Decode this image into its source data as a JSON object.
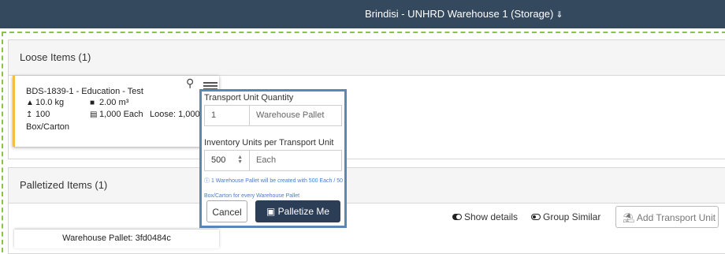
{
  "header": {
    "location": "Brindisi - UNHRD Warehouse 1 (Storage)",
    "chevron_icon": "double-chevron-down"
  },
  "loose": {
    "title": "Loose Items (1)",
    "card": {
      "title": "BDS-1839-1 - Education - Test",
      "weight": "10.0 kg",
      "volume": "2.00 m³",
      "units": "100",
      "quantity": "1,000 Each",
      "loose": "Loose: 1,000",
      "unit_type": "Box/Carton"
    }
  },
  "palletize_popup": {
    "tu_quantity_label": "Transport Unit Quantity",
    "tu_quantity_value": "1",
    "tu_type": "Warehouse Pallet",
    "inv_per_tu_label": "Inventory Units per Transport Unit",
    "inv_per_tu_value": "500",
    "inv_unit": "Each",
    "note": "1 Warehouse Pallet will be created with 500 Each / 50 Box/Carton for every Warehouse Pallet",
    "cancel_label": "Cancel",
    "palletize_label": "Palletize Me"
  },
  "palletized": {
    "title": "Palletized Items (1)",
    "show_details_label": "Show details",
    "group_similar_label": "Group Similar",
    "add_tu_label": "Add Transport Unit",
    "pallet_card_title": "Warehouse Pallet: 3fd0484c"
  },
  "colors": {
    "header_bg": "#34495e",
    "primary_button": "#2c3e55",
    "popup_border": "#5b86b8",
    "card_accent": "#f0c040",
    "dashed_frame": "#8bc34a"
  }
}
